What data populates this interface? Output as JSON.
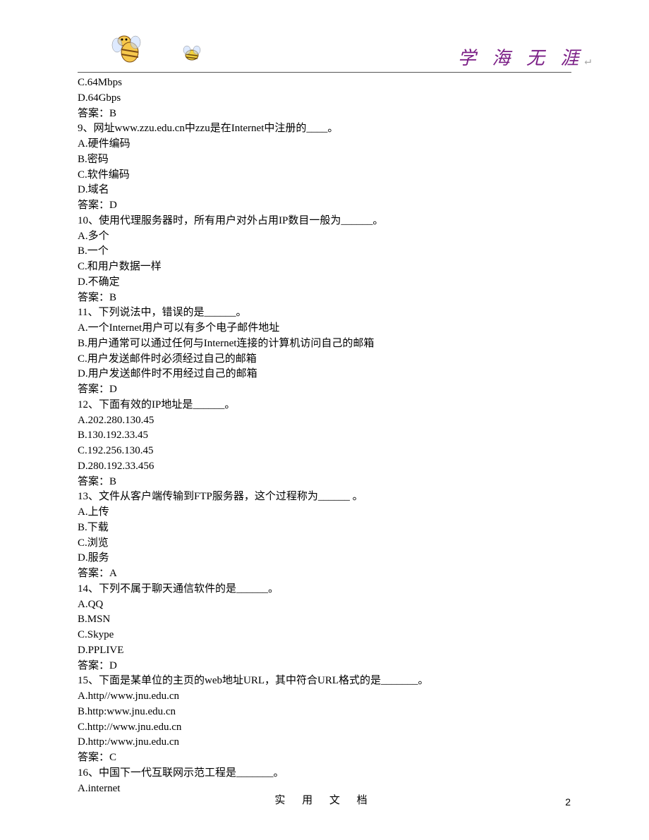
{
  "header": {
    "slogan": "学 海 无 涯",
    "slogan_tail": "↵"
  },
  "lines": [
    "C.64Mbps",
    "D.64Gbps",
    "答案：B",
    "9、网址www.zzu.edu.cn中zzu是在Internet中注册的____。",
    "A.硬件编码",
    "B.密码",
    "C.软件编码",
    "D.域名",
    "答案：D",
    "10、使用代理服务器时，所有用户对外占用IP数目一般为______。",
    "A.多个",
    "B.一个",
    "C.和用户数据一样",
    "D.不确定",
    "答案：B",
    "11、下列说法中，错误的是______。",
    "A.一个Internet用户可以有多个电子邮件地址",
    "B.用户通常可以通过任何与Internet连接的计算机访问自己的邮箱",
    "C.用户发送邮件时必须经过自己的邮箱",
    "D.用户发送邮件时不用经过自己的邮箱",
    "答案：D",
    "12、下面有效的IP地址是______。",
    "A.202.280.130.45",
    "B.130.192.33.45",
    "C.192.256.130.45",
    "D.280.192.33.456",
    "答案：B",
    "13、文件从客户端传输到FTP服务器，这个过程称为______ 。",
    "A.上传",
    "B.下载",
    "C.浏览",
    "D.服务",
    "答案：A",
    "14、下列不属于聊天通信软件的是______。",
    "A.QQ",
    "B.MSN",
    "C.Skype",
    "D.PPLIVE",
    "答案：D",
    "15、下面是某单位的主页的web地址URL，其中符合URL格式的是_______。",
    "A.http//www.jnu.edu.cn",
    "B.http:www.jnu.edu.cn",
    "C.http://www.jnu.edu.cn",
    "D.http:/www.jnu.edu.cn",
    "答案：C",
    "16、中国下一代互联网示范工程是_______。",
    "A.internet"
  ],
  "footer": {
    "text": "实 用 文 档",
    "page_number": "2"
  }
}
